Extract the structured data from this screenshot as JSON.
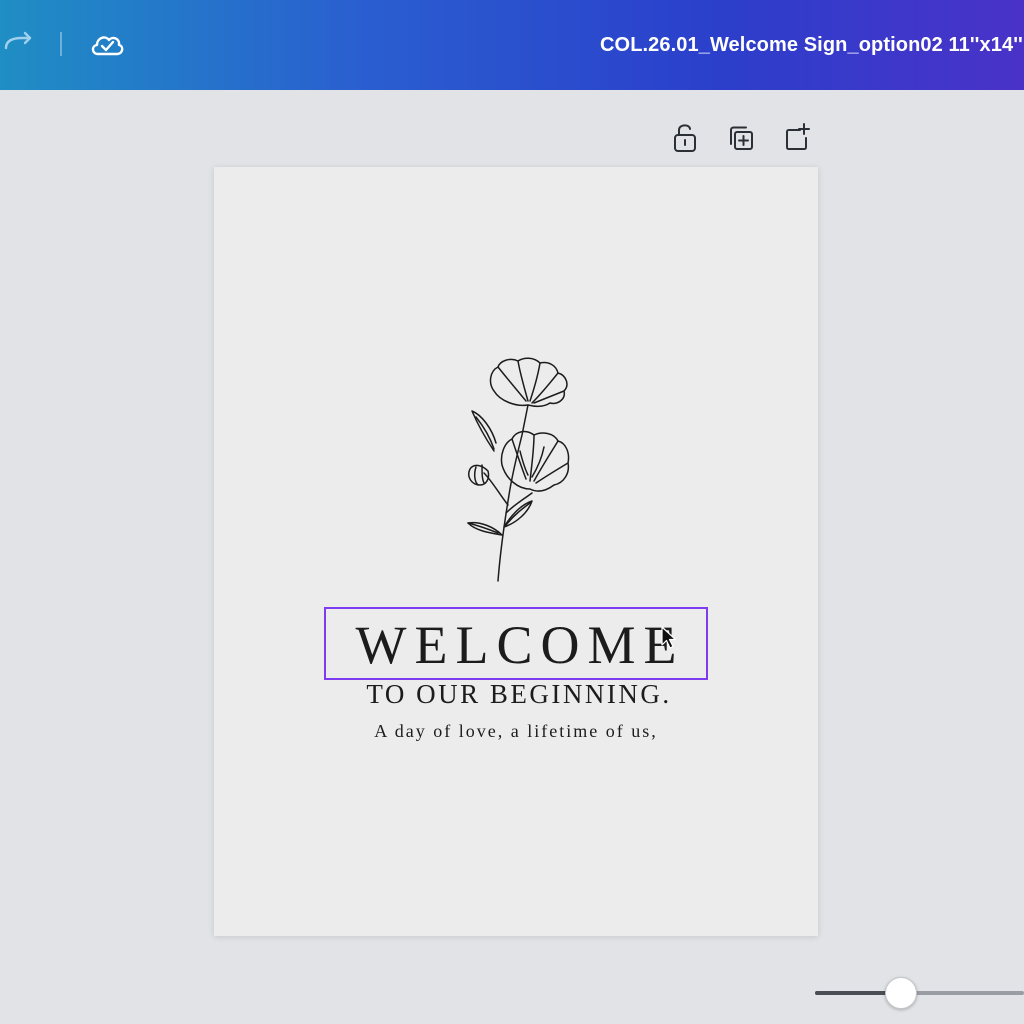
{
  "header": {
    "document_title": "COL.26.01_Welcome Sign_option02 11''x14''",
    "redo_icon": "redo-icon",
    "save_status_icon": "cloud-check-icon"
  },
  "page_toolbar": {
    "icons": [
      "lock-open-icon",
      "duplicate-page-icon",
      "add-page-icon"
    ]
  },
  "canvas": {
    "welcome_heading": "WELCOME",
    "subheading": "TO OUR BEGINNING.",
    "tagline": "A day of love, a lifetime of us,",
    "graphic": "floral-line-art",
    "selection_color": "#7d3cf1"
  },
  "zoom": {
    "slider_level_fraction": 0.42
  },
  "colors": {
    "header_gradient_start": "#1f8ec4",
    "header_gradient_end": "#4a32c8",
    "workspace_bg": "#e1e3e6",
    "page_bg": "#ececec"
  }
}
